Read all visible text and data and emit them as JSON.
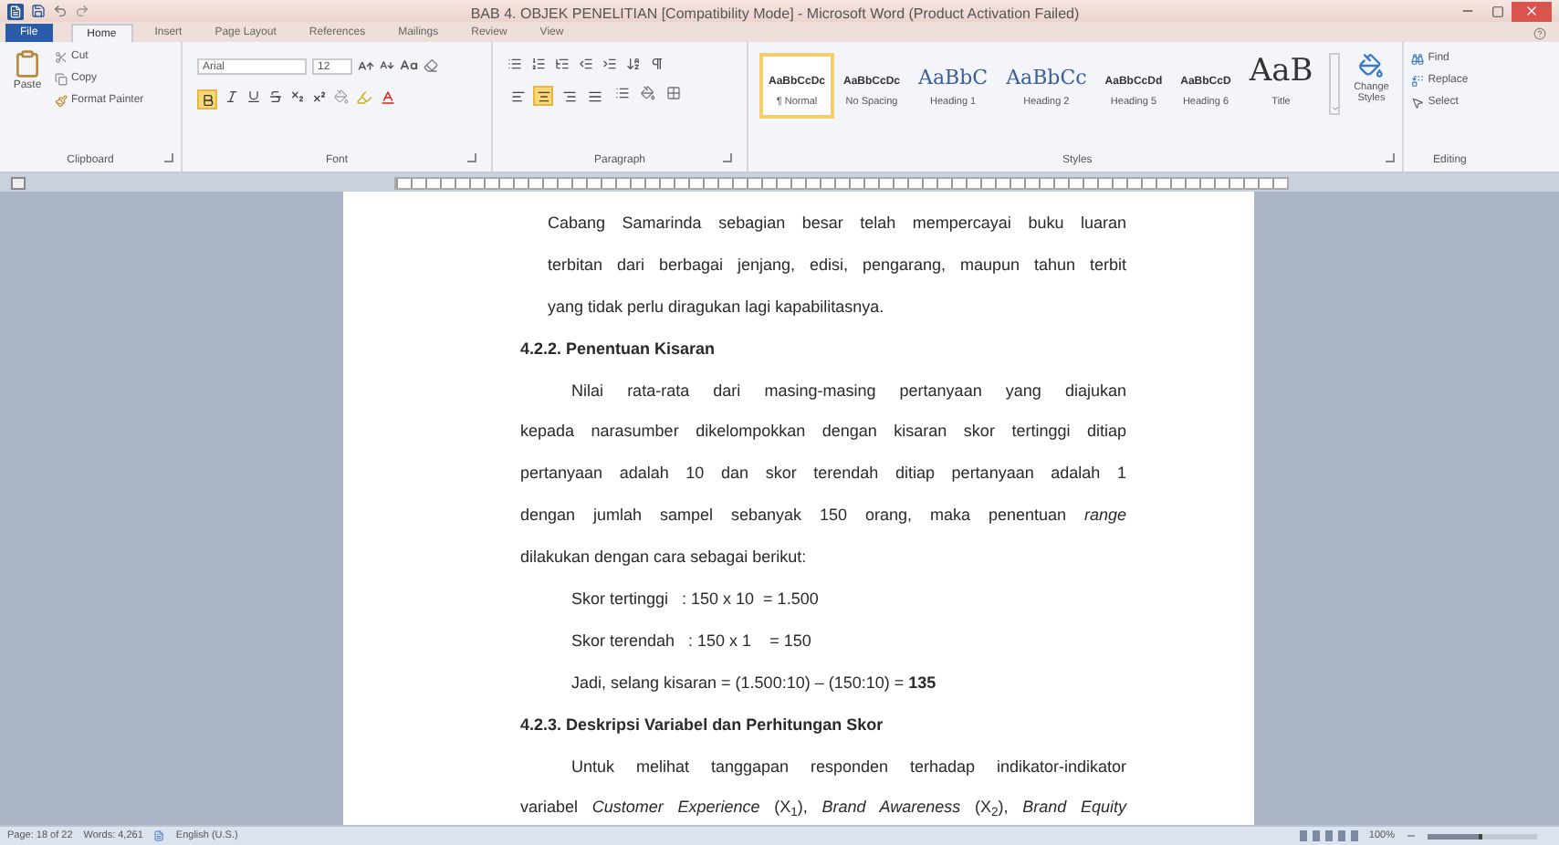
{
  "window": {
    "title": "BAB 4. OBJEK PENELITIAN [Compatibility Mode] - Microsoft Word (Product Activation Failed)"
  },
  "tabs": [
    {
      "label": "File",
      "selected": false,
      "kind": "file"
    },
    {
      "label": "Home",
      "selected": true,
      "kind": "tab"
    },
    {
      "label": "Insert",
      "selected": false,
      "kind": "tab"
    },
    {
      "label": "Page Layout",
      "selected": false,
      "kind": "tab"
    },
    {
      "label": "References",
      "selected": false,
      "kind": "tab"
    },
    {
      "label": "Mailings",
      "selected": false,
      "kind": "tab"
    },
    {
      "label": "Review",
      "selected": false,
      "kind": "tab"
    },
    {
      "label": "View",
      "selected": false,
      "kind": "tab"
    }
  ],
  "clipboard": {
    "paste": "Paste",
    "cut": "Cut",
    "copy": "Copy",
    "format_painter": "Format Painter",
    "label": "Clipboard"
  },
  "font": {
    "name": "Arial",
    "size": "12",
    "bold": true,
    "label": "Font"
  },
  "paragraph": {
    "label": "Paragraph",
    "alignment": [
      {
        "selected": false
      },
      {
        "selected": true
      },
      {
        "selected": false
      },
      {
        "selected": false
      }
    ]
  },
  "styles": {
    "label": "Styles",
    "change_styles": "Change Styles",
    "items": [
      {
        "preview": "AaBbCcDc",
        "name": "¶ Normal",
        "selected": true,
        "kind": "small"
      },
      {
        "preview": "AaBbCcDc",
        "name": "No Spacing",
        "selected": false,
        "kind": "small"
      },
      {
        "preview": "AaBbC",
        "name": "Heading 1",
        "selected": false,
        "kind": "heading"
      },
      {
        "preview": "AaBbCc",
        "name": "Heading 2",
        "selected": false,
        "kind": "heading"
      },
      {
        "preview": "AaBbCcDd",
        "name": "Heading 5",
        "selected": false,
        "kind": "small"
      },
      {
        "preview": "AaBbCcD",
        "name": "Heading 6",
        "selected": false,
        "kind": "small"
      },
      {
        "preview": "AaB",
        "name": "Title",
        "selected": false,
        "kind": "title"
      }
    ]
  },
  "editing": {
    "label": "Editing",
    "find": "Find",
    "replace": "Replace",
    "select": "Select"
  },
  "document": {
    "lines": [
      {
        "kind": "block",
        "text": "Cabang Samarinda sebagian besar telah mempercayai buku luaran"
      },
      {
        "kind": "block",
        "text": "terbitan dari berbagai jenjang, edisi, pengarang, maupun tahun terbit"
      },
      {
        "kind": "block-end",
        "text": "yang tidak perlu diragukan lagi kapabilitasnya."
      },
      {
        "kind": "heading",
        "text": "4.2.2. Penentuan Kisaran"
      },
      {
        "kind": "para-start",
        "text": "Nilai rata-rata dari masing-masing pertanyaan yang diajukan"
      },
      {
        "kind": "body",
        "text": "kepada narasumber dikelompokkan dengan kisaran skor tertinggi ditiap"
      },
      {
        "kind": "body",
        "text": "pertanyaan adalah 10 dan skor terendah ditiap pertanyaan adalah 1"
      },
      {
        "kind": "body",
        "text": "dengan jumlah sampel sebanyak 150 orang, maka penentuan *range*"
      },
      {
        "kind": "body-end",
        "text": "dilakukan dengan cara sebagai berikut:"
      },
      {
        "kind": "formula",
        "text": "Skor tertinggi   : 150 x 10  = 1.500"
      },
      {
        "kind": "formula",
        "text": "Skor terendah   : 150 x 1    = 150"
      },
      {
        "kind": "formula",
        "text": "Jadi, selang kisaran = (1.500:10) – (150:10) = **135**"
      },
      {
        "kind": "heading",
        "text": "4.2.3. Deskripsi Variabel dan Perhitungan Skor"
      },
      {
        "kind": "para-start",
        "text": "Untuk melihat tanggapan responden terhadap indikator-indikator"
      },
      {
        "kind": "body",
        "text": "variabel *Customer Experience* (X$_{1}$), *Brand Awareness* (X$_{2}$), *Brand Equity*"
      }
    ]
  },
  "status_bar": {
    "page": "Page: 18 of 22",
    "words": "Words: 4,261",
    "language": "English (U.S.)",
    "zoom": "100%",
    "zoom_slider": {
      "level": 0.5
    }
  }
}
